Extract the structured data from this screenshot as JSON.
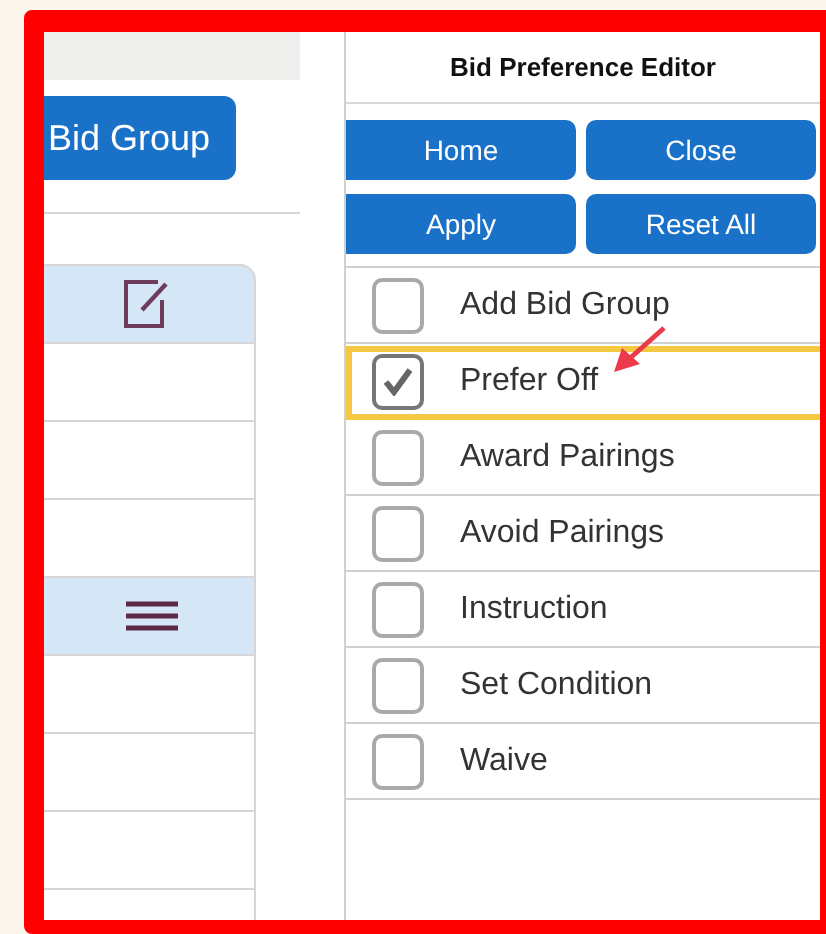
{
  "left_panel": {
    "button": "Bid Group",
    "rows": [
      {
        "kind": "edit",
        "selected": true
      },
      {
        "kind": "blank",
        "selected": false
      },
      {
        "kind": "blank",
        "selected": false
      },
      {
        "kind": "blank",
        "selected": false
      },
      {
        "kind": "list",
        "selected": true
      },
      {
        "kind": "blank",
        "selected": false
      },
      {
        "kind": "blank",
        "selected": false
      },
      {
        "kind": "blank",
        "selected": false
      },
      {
        "kind": "blank",
        "selected": false
      }
    ]
  },
  "editor": {
    "title": "Bid Preference Editor",
    "buttons": [
      "Home",
      "Close",
      "Apply",
      "Reset All"
    ],
    "options": [
      {
        "label": "Add Bid Group",
        "checked": false,
        "highlighted": false
      },
      {
        "label": "Prefer Off",
        "checked": true,
        "highlighted": true
      },
      {
        "label": "Award Pairings",
        "checked": false,
        "highlighted": false
      },
      {
        "label": "Avoid Pairings",
        "checked": false,
        "highlighted": false
      },
      {
        "label": "Instruction",
        "checked": false,
        "highlighted": false
      },
      {
        "label": "Set Condition",
        "checked": false,
        "highlighted": false
      },
      {
        "label": "Waive",
        "checked": false,
        "highlighted": false
      }
    ]
  }
}
